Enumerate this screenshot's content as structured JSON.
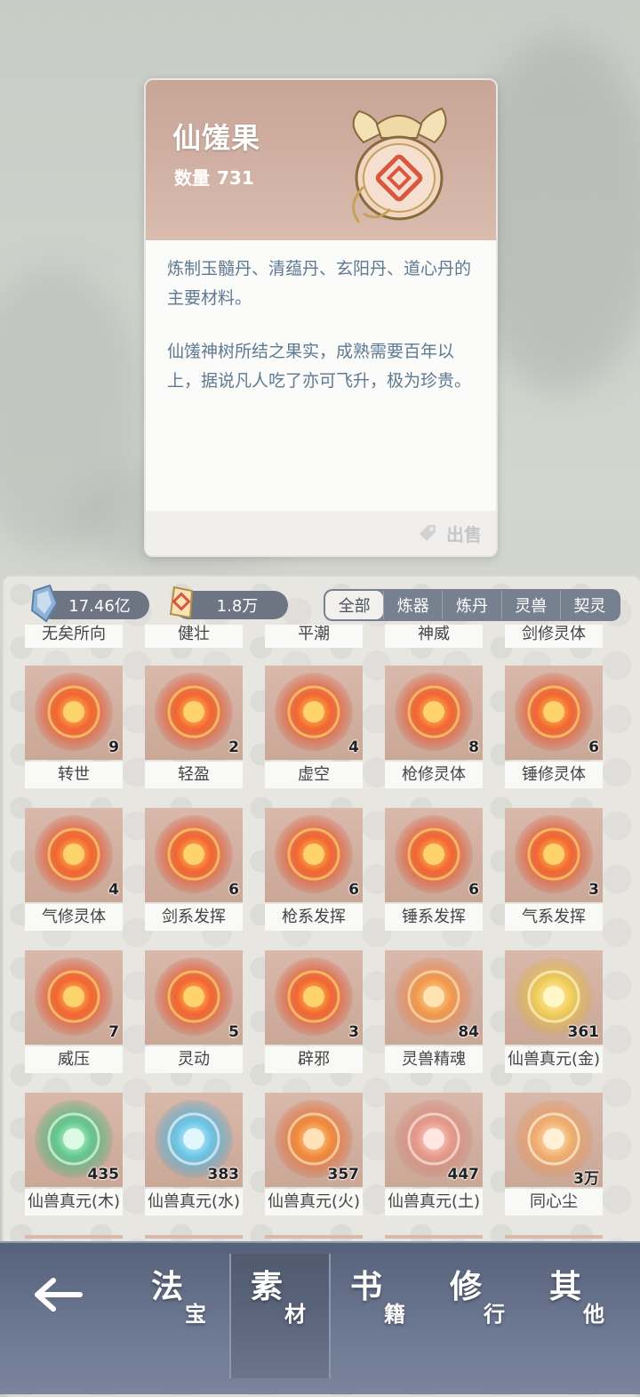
{
  "detail": {
    "title": "仙馐果",
    "quantity_label": "数量",
    "quantity": "731",
    "desc1": "炼制玉髓丹、清蕴丹、玄阳丹、道心丹的主要材料。",
    "desc2": "仙馐神树所结之果实，成熟需要百年以上，据说凡人吃了亦可飞升，极为珍贵。",
    "sell_label": "出售"
  },
  "currency": {
    "crystal": "17.46亿",
    "jade": "1.8万"
  },
  "tabs": [
    "全部",
    "炼器",
    "炼丹",
    "灵兽",
    "契灵"
  ],
  "active_tab": "全部",
  "partial_row": [
    "无矣所向",
    "健壮",
    "平潮",
    "神威",
    "剑修灵体"
  ],
  "items": [
    {
      "label": "转世",
      "count": "9",
      "icon": "red-orb-icon"
    },
    {
      "label": "轻盈",
      "count": "2",
      "icon": "red-orb-icon"
    },
    {
      "label": "虚空",
      "count": "4",
      "icon": "red-orb-icon"
    },
    {
      "label": "枪修灵体",
      "count": "8",
      "icon": "red-orb-icon"
    },
    {
      "label": "锤修灵体",
      "count": "6",
      "icon": "red-orb-icon"
    },
    {
      "label": "气修灵体",
      "count": "4",
      "icon": "red-orb-icon"
    },
    {
      "label": "剑系发挥",
      "count": "6",
      "icon": "red-orb-icon"
    },
    {
      "label": "枪系发挥",
      "count": "6",
      "icon": "red-orb-icon"
    },
    {
      "label": "锤系发挥",
      "count": "6",
      "icon": "red-orb-icon"
    },
    {
      "label": "气系发挥",
      "count": "3",
      "icon": "red-orb-icon"
    },
    {
      "label": "威压",
      "count": "7",
      "icon": "red-orb-icon"
    },
    {
      "label": "灵动",
      "count": "5",
      "icon": "red-orb-icon"
    },
    {
      "label": "辟邪",
      "count": "3",
      "icon": "red-orb-icon"
    },
    {
      "label": "灵兽精魂",
      "count": "84",
      "icon": "spirit-flame-icon"
    },
    {
      "label": "仙兽真元(金)",
      "count": "361",
      "icon": "gold-beast-essence-icon"
    },
    {
      "label": "仙兽真元(木)",
      "count": "435",
      "icon": "green-beast-essence-icon"
    },
    {
      "label": "仙兽真元(水)",
      "count": "383",
      "icon": "blue-beast-essence-icon"
    },
    {
      "label": "仙兽真元(火)",
      "count": "357",
      "icon": "fire-beast-essence-icon"
    },
    {
      "label": "仙兽真元(土)",
      "count": "447",
      "icon": "earth-beast-essence-icon"
    },
    {
      "label": "同心尘",
      "count": "3万",
      "icon": "dust-icon"
    }
  ],
  "nav": [
    {
      "big": "法",
      "small": "宝",
      "active": false
    },
    {
      "big": "素",
      "small": "材",
      "active": true
    },
    {
      "big": "书",
      "small": "籍",
      "active": false
    },
    {
      "big": "修",
      "small": "行",
      "active": false
    },
    {
      "big": "其",
      "small": "他",
      "active": false
    }
  ],
  "colors": {
    "card_header": "#c9a899",
    "desc_text": "#5e7a93",
    "tab_bar": "#77808f",
    "nav_bar": "#5f6a83"
  }
}
